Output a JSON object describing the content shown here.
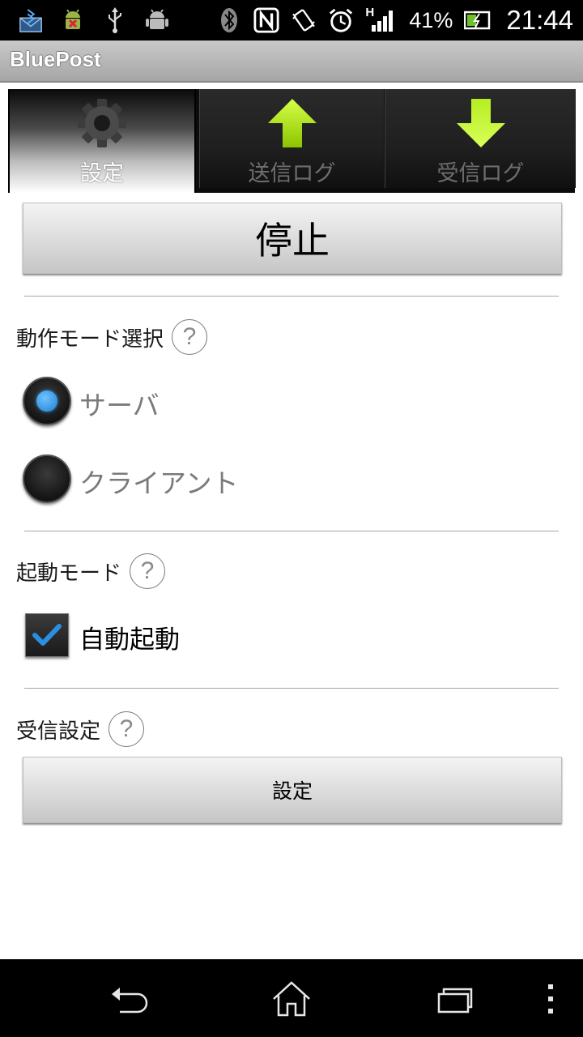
{
  "status_bar": {
    "left_icons": [
      "bluetooth-mail-icon",
      "android-debug-icon",
      "usb-icon",
      "android-icon"
    ],
    "right_icons": [
      "bluetooth-icon",
      "nfc-icon",
      "vibrate-icon",
      "alarm-icon",
      "hspa-signal-icon",
      "battery-icon"
    ],
    "network_type": "H",
    "battery_percent": "41%",
    "time": "21:44"
  },
  "action_bar": {
    "title": "BluePost"
  },
  "tabs": [
    {
      "label": "設定",
      "icon": "gear-icon",
      "selected": true
    },
    {
      "label": "送信ログ",
      "icon": "arrow-up-icon",
      "selected": false
    },
    {
      "label": "受信ログ",
      "icon": "arrow-down-icon",
      "selected": false
    }
  ],
  "main": {
    "stop_button": "停止",
    "operation_mode": {
      "label": "動作モード選択",
      "help": "?",
      "options": [
        {
          "label": "サーバ",
          "checked": true
        },
        {
          "label": "クライアント",
          "checked": false
        }
      ]
    },
    "startup_mode": {
      "label": "起動モード",
      "help": "?",
      "auto_start": {
        "label": "自動起動",
        "checked": true
      }
    },
    "receive_settings": {
      "label": "受信設定",
      "help": "?",
      "button": "設定"
    }
  },
  "colors": {
    "accent_blue": "#2a8fe0",
    "tab_arrow_green": "#a8e000",
    "background": "#ffffff"
  }
}
